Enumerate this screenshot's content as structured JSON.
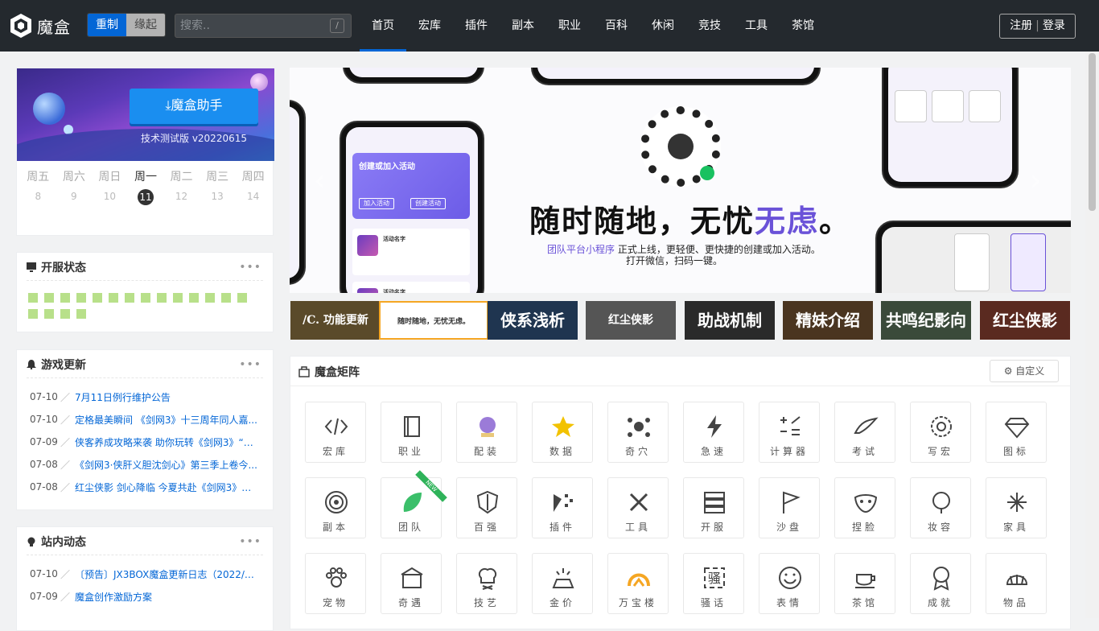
{
  "header": {
    "app_name": "魔盒",
    "seg_active": "重制",
    "seg_inactive": "缘起",
    "search_placeholder": "搜索..",
    "search_shortcut": "/",
    "nav": [
      "首页",
      "宏库",
      "插件",
      "副本",
      "职业",
      "百科",
      "休闲",
      "竞技",
      "工具",
      "茶馆"
    ],
    "register": "注册",
    "auth_sep": "|",
    "login": "登录"
  },
  "assistant": {
    "button": "⤓魔盒助手",
    "version": "技术测试版 v20220615"
  },
  "calendar": [
    {
      "dow": "周五",
      "day": "8"
    },
    {
      "dow": "周六",
      "day": "9"
    },
    {
      "dow": "周日",
      "day": "10"
    },
    {
      "dow": "周一",
      "day": "11"
    },
    {
      "dow": "周二",
      "day": "12"
    },
    {
      "dow": "周三",
      "day": "13"
    },
    {
      "dow": "周四",
      "day": "14"
    }
  ],
  "server_status": {
    "title": "开服状态",
    "more": "•••",
    "status_color": "#b8e08a"
  },
  "game_updates": {
    "title": "游戏更新",
    "more": "•••",
    "items": [
      {
        "date": "07-10",
        "title": "7月11日例行维护公告"
      },
      {
        "date": "07-10",
        "title": "定格最美瞬间 《剑网3》十三周年同人嘉..."
      },
      {
        "date": "07-09",
        "title": "侠客养成攻略来袭 助你玩转《剑网3》“红..."
      },
      {
        "date": "07-08",
        "title": "《剑网3·侠肝义胆沈剑心》第三季上卷今..."
      },
      {
        "date": "07-08",
        "title": "红尘侠影 剑心降临 今夏共赴《剑网3》全..."
      }
    ]
  },
  "site_news": {
    "title": "站内动态",
    "more": "•••",
    "items": [
      {
        "date": "07-10",
        "title": "〔预告〕JX3BOX魔盒更新日志（2022/7/..."
      },
      {
        "date": "07-09",
        "title": "魔盒创作激励方案"
      }
    ]
  },
  "carousel": {
    "slogan_a": "随时随地，无忧",
    "slogan_b": "无虑",
    "slogan_c": "。",
    "sub_link": "团队平台小程序",
    "sub_text": " 正式上线，更轻便、更快捷的创建或加入活动。",
    "sub_text2": "打开微信，扫码一键。",
    "card_title": "创建或加入活动",
    "join_btn": "加入活动",
    "create_btn": "创建活动",
    "event_name": "活动名字"
  },
  "thumbnails": [
    "/C. 功能更新",
    "随时随地，无忧无虑。",
    "侠系浅析",
    "红尘侠影",
    "助战机制",
    "精妹介绍",
    "共鸣纪影向",
    "红尘侠影"
  ],
  "matrix": {
    "title": "魔盒矩阵",
    "custom_button": "⚙ 自定义",
    "new_badge": "NEW",
    "tiles": [
      [
        "宏库",
        "职业",
        "配装",
        "数据",
        "奇穴",
        "急速",
        "计算器",
        "考试",
        "写宏",
        "图标"
      ],
      [
        "副本",
        "团队",
        "百强",
        "插件",
        "工具",
        "开服",
        "沙盘",
        "捏脸",
        "妆容",
        "家具"
      ],
      [
        "宠物",
        "奇遇",
        "技艺",
        "金价",
        "万宝楼",
        "骚话",
        "表情",
        "茶馆",
        "成就",
        "物品"
      ]
    ]
  }
}
